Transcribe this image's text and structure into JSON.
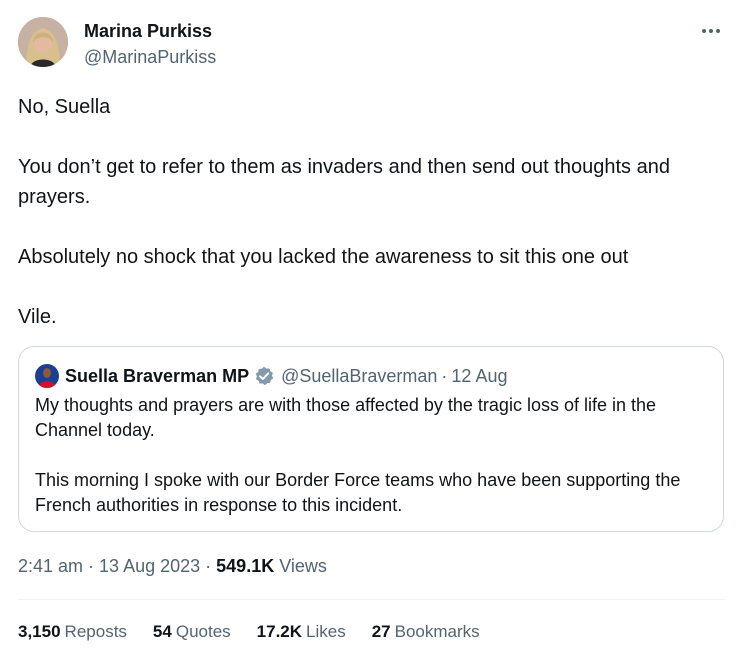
{
  "author": {
    "name": "Marina Purkiss",
    "handle": "@MarinaPurkiss"
  },
  "more_icon": "more-horizontal-icon",
  "body": {
    "line1": "No, Suella",
    "line2": "You don’t get to refer to them as invaders and then send out thoughts and prayers.",
    "line3": "Absolutely no shock that you lacked the awareness to sit this one out",
    "line4": "Vile."
  },
  "quote": {
    "name": "Suella Braverman MP",
    "handle": "@SuellaBraverman",
    "separator": "·",
    "date": "12 Aug",
    "verified_icon": "verified-badge-icon",
    "verified_color": "#829aab",
    "para1": "My thoughts and prayers are with those affected by the tragic loss of life in the Channel today.",
    "para2": "This morning I spoke with our Border Force teams who have been supporting the French authorities in response to this incident."
  },
  "meta": {
    "time": "2:41 am",
    "date": "13 Aug 2023",
    "separator": "·",
    "views_count": "549.1K",
    "views_label": "Views"
  },
  "stats": {
    "reposts_count": "3,150",
    "reposts_label": "Reposts",
    "quotes_count": "54",
    "quotes_label": "Quotes",
    "likes_count": "17.2K",
    "likes_label": "Likes",
    "bookmarks_count": "27",
    "bookmarks_label": "Bookmarks"
  },
  "colors": {
    "text_primary": "#0f1419",
    "text_secondary": "#536471",
    "border": "#cfd9de",
    "divider": "#eff3f4"
  }
}
